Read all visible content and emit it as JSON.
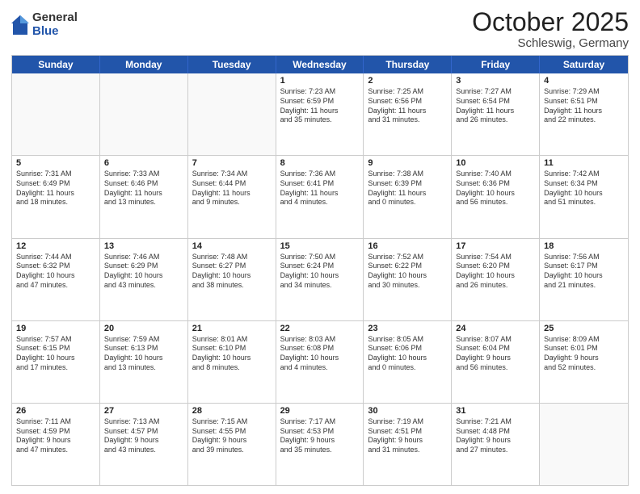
{
  "logo": {
    "general": "General",
    "blue": "Blue"
  },
  "title": "October 2025",
  "subtitle": "Schleswig, Germany",
  "header_days": [
    "Sunday",
    "Monday",
    "Tuesday",
    "Wednesday",
    "Thursday",
    "Friday",
    "Saturday"
  ],
  "rows": [
    [
      {
        "day": "",
        "info": ""
      },
      {
        "day": "",
        "info": ""
      },
      {
        "day": "",
        "info": ""
      },
      {
        "day": "1",
        "info": "Sunrise: 7:23 AM\nSunset: 6:59 PM\nDaylight: 11 hours\nand 35 minutes."
      },
      {
        "day": "2",
        "info": "Sunrise: 7:25 AM\nSunset: 6:56 PM\nDaylight: 11 hours\nand 31 minutes."
      },
      {
        "day": "3",
        "info": "Sunrise: 7:27 AM\nSunset: 6:54 PM\nDaylight: 11 hours\nand 26 minutes."
      },
      {
        "day": "4",
        "info": "Sunrise: 7:29 AM\nSunset: 6:51 PM\nDaylight: 11 hours\nand 22 minutes."
      }
    ],
    [
      {
        "day": "5",
        "info": "Sunrise: 7:31 AM\nSunset: 6:49 PM\nDaylight: 11 hours\nand 18 minutes."
      },
      {
        "day": "6",
        "info": "Sunrise: 7:33 AM\nSunset: 6:46 PM\nDaylight: 11 hours\nand 13 minutes."
      },
      {
        "day": "7",
        "info": "Sunrise: 7:34 AM\nSunset: 6:44 PM\nDaylight: 11 hours\nand 9 minutes."
      },
      {
        "day": "8",
        "info": "Sunrise: 7:36 AM\nSunset: 6:41 PM\nDaylight: 11 hours\nand 4 minutes."
      },
      {
        "day": "9",
        "info": "Sunrise: 7:38 AM\nSunset: 6:39 PM\nDaylight: 11 hours\nand 0 minutes."
      },
      {
        "day": "10",
        "info": "Sunrise: 7:40 AM\nSunset: 6:36 PM\nDaylight: 10 hours\nand 56 minutes."
      },
      {
        "day": "11",
        "info": "Sunrise: 7:42 AM\nSunset: 6:34 PM\nDaylight: 10 hours\nand 51 minutes."
      }
    ],
    [
      {
        "day": "12",
        "info": "Sunrise: 7:44 AM\nSunset: 6:32 PM\nDaylight: 10 hours\nand 47 minutes."
      },
      {
        "day": "13",
        "info": "Sunrise: 7:46 AM\nSunset: 6:29 PM\nDaylight: 10 hours\nand 43 minutes."
      },
      {
        "day": "14",
        "info": "Sunrise: 7:48 AM\nSunset: 6:27 PM\nDaylight: 10 hours\nand 38 minutes."
      },
      {
        "day": "15",
        "info": "Sunrise: 7:50 AM\nSunset: 6:24 PM\nDaylight: 10 hours\nand 34 minutes."
      },
      {
        "day": "16",
        "info": "Sunrise: 7:52 AM\nSunset: 6:22 PM\nDaylight: 10 hours\nand 30 minutes."
      },
      {
        "day": "17",
        "info": "Sunrise: 7:54 AM\nSunset: 6:20 PM\nDaylight: 10 hours\nand 26 minutes."
      },
      {
        "day": "18",
        "info": "Sunrise: 7:56 AM\nSunset: 6:17 PM\nDaylight: 10 hours\nand 21 minutes."
      }
    ],
    [
      {
        "day": "19",
        "info": "Sunrise: 7:57 AM\nSunset: 6:15 PM\nDaylight: 10 hours\nand 17 minutes."
      },
      {
        "day": "20",
        "info": "Sunrise: 7:59 AM\nSunset: 6:13 PM\nDaylight: 10 hours\nand 13 minutes."
      },
      {
        "day": "21",
        "info": "Sunrise: 8:01 AM\nSunset: 6:10 PM\nDaylight: 10 hours\nand 8 minutes."
      },
      {
        "day": "22",
        "info": "Sunrise: 8:03 AM\nSunset: 6:08 PM\nDaylight: 10 hours\nand 4 minutes."
      },
      {
        "day": "23",
        "info": "Sunrise: 8:05 AM\nSunset: 6:06 PM\nDaylight: 10 hours\nand 0 minutes."
      },
      {
        "day": "24",
        "info": "Sunrise: 8:07 AM\nSunset: 6:04 PM\nDaylight: 9 hours\nand 56 minutes."
      },
      {
        "day": "25",
        "info": "Sunrise: 8:09 AM\nSunset: 6:01 PM\nDaylight: 9 hours\nand 52 minutes."
      }
    ],
    [
      {
        "day": "26",
        "info": "Sunrise: 7:11 AM\nSunset: 4:59 PM\nDaylight: 9 hours\nand 47 minutes."
      },
      {
        "day": "27",
        "info": "Sunrise: 7:13 AM\nSunset: 4:57 PM\nDaylight: 9 hours\nand 43 minutes."
      },
      {
        "day": "28",
        "info": "Sunrise: 7:15 AM\nSunset: 4:55 PM\nDaylight: 9 hours\nand 39 minutes."
      },
      {
        "day": "29",
        "info": "Sunrise: 7:17 AM\nSunset: 4:53 PM\nDaylight: 9 hours\nand 35 minutes."
      },
      {
        "day": "30",
        "info": "Sunrise: 7:19 AM\nSunset: 4:51 PM\nDaylight: 9 hours\nand 31 minutes."
      },
      {
        "day": "31",
        "info": "Sunrise: 7:21 AM\nSunset: 4:48 PM\nDaylight: 9 hours\nand 27 minutes."
      },
      {
        "day": "",
        "info": ""
      }
    ]
  ]
}
